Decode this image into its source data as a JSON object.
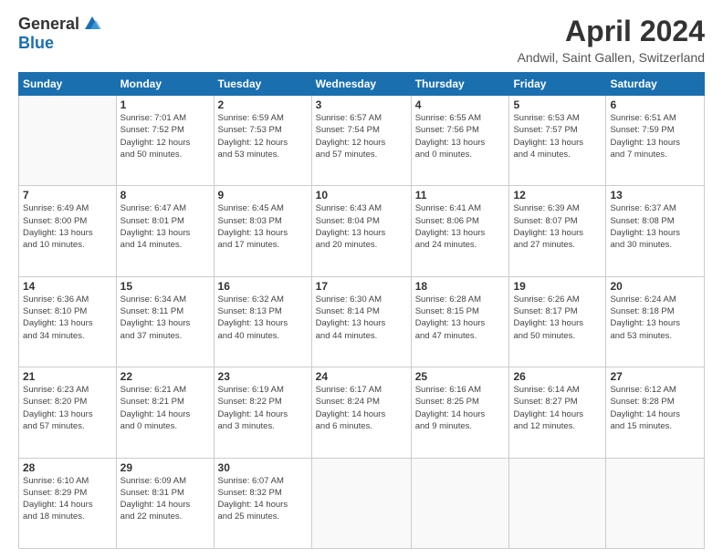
{
  "logo": {
    "general": "General",
    "blue": "Blue"
  },
  "title": "April 2024",
  "location": "Andwil, Saint Gallen, Switzerland",
  "days_header": [
    "Sunday",
    "Monday",
    "Tuesday",
    "Wednesday",
    "Thursday",
    "Friday",
    "Saturday"
  ],
  "weeks": [
    [
      {
        "num": "",
        "info": ""
      },
      {
        "num": "1",
        "info": "Sunrise: 7:01 AM\nSunset: 7:52 PM\nDaylight: 12 hours\nand 50 minutes."
      },
      {
        "num": "2",
        "info": "Sunrise: 6:59 AM\nSunset: 7:53 PM\nDaylight: 12 hours\nand 53 minutes."
      },
      {
        "num": "3",
        "info": "Sunrise: 6:57 AM\nSunset: 7:54 PM\nDaylight: 12 hours\nand 57 minutes."
      },
      {
        "num": "4",
        "info": "Sunrise: 6:55 AM\nSunset: 7:56 PM\nDaylight: 13 hours\nand 0 minutes."
      },
      {
        "num": "5",
        "info": "Sunrise: 6:53 AM\nSunset: 7:57 PM\nDaylight: 13 hours\nand 4 minutes."
      },
      {
        "num": "6",
        "info": "Sunrise: 6:51 AM\nSunset: 7:59 PM\nDaylight: 13 hours\nand 7 minutes."
      }
    ],
    [
      {
        "num": "7",
        "info": "Sunrise: 6:49 AM\nSunset: 8:00 PM\nDaylight: 13 hours\nand 10 minutes."
      },
      {
        "num": "8",
        "info": "Sunrise: 6:47 AM\nSunset: 8:01 PM\nDaylight: 13 hours\nand 14 minutes."
      },
      {
        "num": "9",
        "info": "Sunrise: 6:45 AM\nSunset: 8:03 PM\nDaylight: 13 hours\nand 17 minutes."
      },
      {
        "num": "10",
        "info": "Sunrise: 6:43 AM\nSunset: 8:04 PM\nDaylight: 13 hours\nand 20 minutes."
      },
      {
        "num": "11",
        "info": "Sunrise: 6:41 AM\nSunset: 8:06 PM\nDaylight: 13 hours\nand 24 minutes."
      },
      {
        "num": "12",
        "info": "Sunrise: 6:39 AM\nSunset: 8:07 PM\nDaylight: 13 hours\nand 27 minutes."
      },
      {
        "num": "13",
        "info": "Sunrise: 6:37 AM\nSunset: 8:08 PM\nDaylight: 13 hours\nand 30 minutes."
      }
    ],
    [
      {
        "num": "14",
        "info": "Sunrise: 6:36 AM\nSunset: 8:10 PM\nDaylight: 13 hours\nand 34 minutes."
      },
      {
        "num": "15",
        "info": "Sunrise: 6:34 AM\nSunset: 8:11 PM\nDaylight: 13 hours\nand 37 minutes."
      },
      {
        "num": "16",
        "info": "Sunrise: 6:32 AM\nSunset: 8:13 PM\nDaylight: 13 hours\nand 40 minutes."
      },
      {
        "num": "17",
        "info": "Sunrise: 6:30 AM\nSunset: 8:14 PM\nDaylight: 13 hours\nand 44 minutes."
      },
      {
        "num": "18",
        "info": "Sunrise: 6:28 AM\nSunset: 8:15 PM\nDaylight: 13 hours\nand 47 minutes."
      },
      {
        "num": "19",
        "info": "Sunrise: 6:26 AM\nSunset: 8:17 PM\nDaylight: 13 hours\nand 50 minutes."
      },
      {
        "num": "20",
        "info": "Sunrise: 6:24 AM\nSunset: 8:18 PM\nDaylight: 13 hours\nand 53 minutes."
      }
    ],
    [
      {
        "num": "21",
        "info": "Sunrise: 6:23 AM\nSunset: 8:20 PM\nDaylight: 13 hours\nand 57 minutes."
      },
      {
        "num": "22",
        "info": "Sunrise: 6:21 AM\nSunset: 8:21 PM\nDaylight: 14 hours\nand 0 minutes."
      },
      {
        "num": "23",
        "info": "Sunrise: 6:19 AM\nSunset: 8:22 PM\nDaylight: 14 hours\nand 3 minutes."
      },
      {
        "num": "24",
        "info": "Sunrise: 6:17 AM\nSunset: 8:24 PM\nDaylight: 14 hours\nand 6 minutes."
      },
      {
        "num": "25",
        "info": "Sunrise: 6:16 AM\nSunset: 8:25 PM\nDaylight: 14 hours\nand 9 minutes."
      },
      {
        "num": "26",
        "info": "Sunrise: 6:14 AM\nSunset: 8:27 PM\nDaylight: 14 hours\nand 12 minutes."
      },
      {
        "num": "27",
        "info": "Sunrise: 6:12 AM\nSunset: 8:28 PM\nDaylight: 14 hours\nand 15 minutes."
      }
    ],
    [
      {
        "num": "28",
        "info": "Sunrise: 6:10 AM\nSunset: 8:29 PM\nDaylight: 14 hours\nand 18 minutes."
      },
      {
        "num": "29",
        "info": "Sunrise: 6:09 AM\nSunset: 8:31 PM\nDaylight: 14 hours\nand 22 minutes."
      },
      {
        "num": "30",
        "info": "Sunrise: 6:07 AM\nSunset: 8:32 PM\nDaylight: 14 hours\nand 25 minutes."
      },
      {
        "num": "",
        "info": ""
      },
      {
        "num": "",
        "info": ""
      },
      {
        "num": "",
        "info": ""
      },
      {
        "num": "",
        "info": ""
      }
    ]
  ]
}
